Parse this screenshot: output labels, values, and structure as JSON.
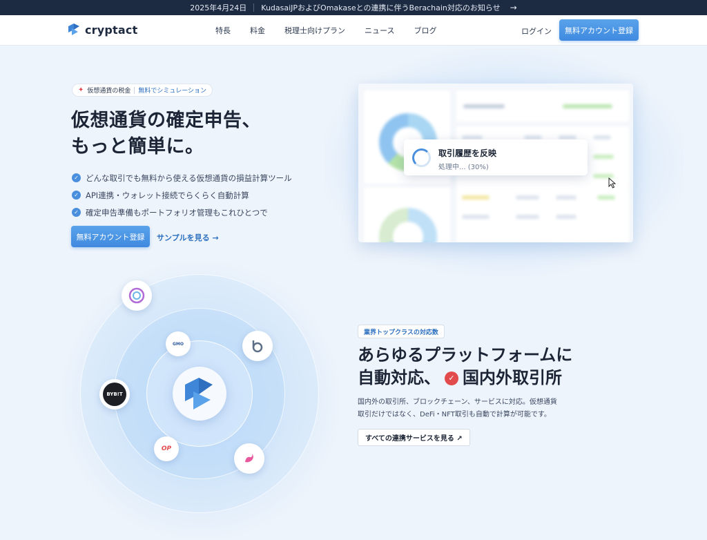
{
  "announcement": {
    "date": "2025年4月24日",
    "text": "KudasaiJPおよびOmakaseとの連携に伴うBerachain対応のお知らせ",
    "arrow": "→"
  },
  "header": {
    "logo_text": "cryptact",
    "nav": [
      "特長",
      "料金",
      "税理士向けプラン",
      "ニュース",
      "ブログ"
    ],
    "login": "ログイン",
    "signup": "無料アカウント登録"
  },
  "hero": {
    "tag_left": "仮想通貨の税金",
    "tag_right": "無料でシミュレーション",
    "title_line1": "仮想通貨の確定申告、",
    "title_line2": "もっと簡単に。",
    "checks": [
      "どんな取引でも無料から使える仮想通貨の損益計算ツール",
      "API連携・ウォレット接続でらくらく自動計算",
      "確定申告準備もポートフォリオ管理もこれひとつで"
    ],
    "cta": "無料アカウント登録",
    "sample_link": "サンプルを見る →"
  },
  "progress": {
    "title": "取引履歴を反映",
    "status": "処理中... (30%)",
    "percent": 30
  },
  "platforms": {
    "tag": "業界トップクラスの対応数",
    "title_line1": "あらゆるプラットフォームに",
    "title_line2_a": "自動対応、",
    "title_line2_b": "国内外取引所",
    "desc_line1": "国内外の取引所、ブロックチェーン、サービスに対応。仮想通貨",
    "desc_line2": "取引だけではなく、DeFi・NFT取引も自動で計算が可能です。",
    "button": "すべての連携サービスを見る ↗",
    "orbs": {
      "bybit": "BYB!T",
      "op": "OP",
      "gmo": "GMO"
    }
  },
  "colors": {
    "accent": "#4a8fde",
    "dark": "#1c2a42",
    "check_red": "#e24b4b"
  }
}
